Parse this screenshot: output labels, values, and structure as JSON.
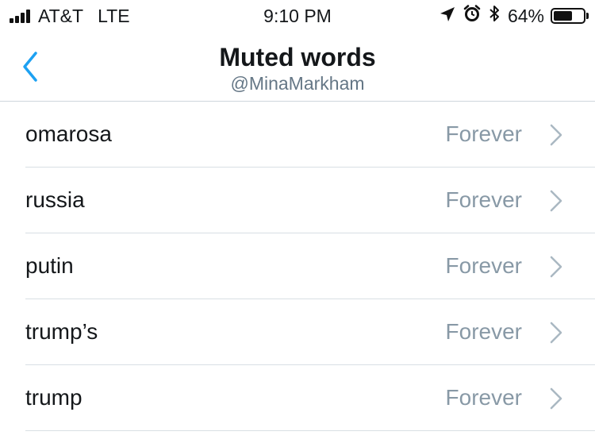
{
  "status_bar": {
    "carrier": "AT&T",
    "network": "LTE",
    "time": "9:10 PM",
    "battery_percent": "64%",
    "battery_level": 0.64,
    "icons": [
      "signal-icon",
      "location-arrow-icon",
      "alarm-icon",
      "bluetooth-icon",
      "battery-icon"
    ]
  },
  "nav": {
    "title": "Muted words",
    "subtitle": "@MinaMarkham",
    "back_icon": "chevron-left-icon"
  },
  "muted_words": [
    {
      "word": "omarosa",
      "duration": "Forever"
    },
    {
      "word": "russia",
      "duration": "Forever"
    },
    {
      "word": "putin",
      "duration": "Forever"
    },
    {
      "word": "trump’s",
      "duration": "Forever"
    },
    {
      "word": "trump",
      "duration": "Forever"
    }
  ],
  "colors": {
    "accent": "#1da1f2",
    "text_primary": "#14171a",
    "text_secondary": "#657786",
    "duration_text": "#8899a6",
    "separator": "#d8dfe4"
  }
}
